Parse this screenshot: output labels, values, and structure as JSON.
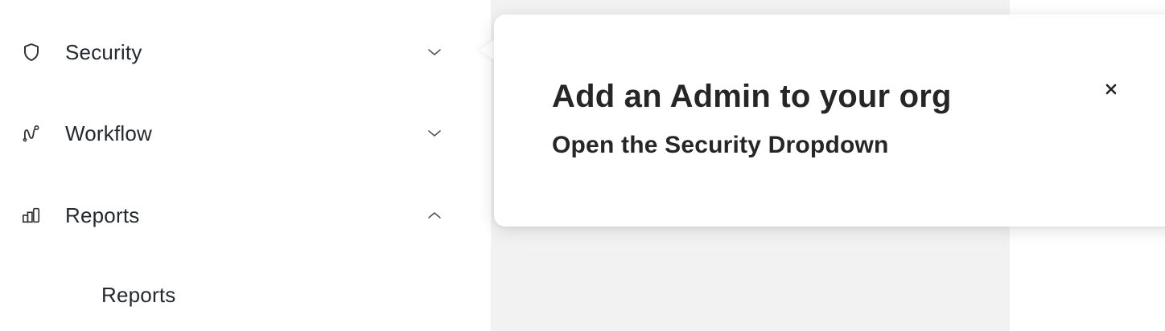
{
  "sidebar": {
    "items": [
      {
        "label": "Security",
        "icon": "shield-icon",
        "chevron": "chevron-down-icon",
        "expanded": false
      },
      {
        "label": "Workflow",
        "icon": "workflow-icon",
        "chevron": "chevron-down-icon",
        "expanded": false
      },
      {
        "label": "Reports",
        "icon": "bar-chart-icon",
        "chevron": "chevron-up-icon",
        "expanded": true
      }
    ],
    "subitems": [
      {
        "label": "Reports"
      }
    ]
  },
  "popover": {
    "title": "Add an Admin to your org",
    "subtitle": "Open the Security Dropdown",
    "close_label": "×"
  },
  "colors": {
    "main_background": "#f2f2f2",
    "sidebar_background": "#ffffff",
    "popover_background": "#ffffff",
    "text": "#24292f",
    "icon": "#333333"
  }
}
